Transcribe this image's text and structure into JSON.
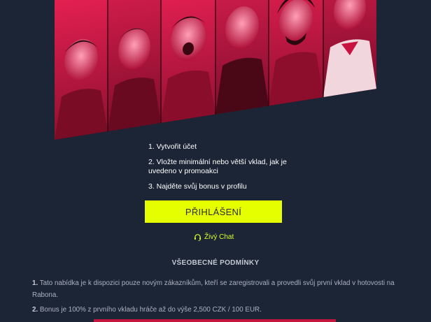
{
  "banner": {
    "players": [
      {
        "name": "player-1"
      },
      {
        "name": "player-2"
      },
      {
        "name": "player-3"
      },
      {
        "name": "player-4"
      },
      {
        "name": "player-5"
      },
      {
        "name": "player-6"
      }
    ],
    "accent_color": "#e0144a"
  },
  "steps": [
    {
      "text": "1. Vytvořit účet"
    },
    {
      "text": "2. Vložte minimální nebo větší vklad, jak je uvedeno v promoakci"
    },
    {
      "text": "3. Najděte svůj bonus v profilu"
    }
  ],
  "login_button": {
    "label": "PŘIHLÁŠENÍ",
    "color": "#e6ff00"
  },
  "chat": {
    "label": "Živý Chat",
    "icon": "headset-icon"
  },
  "terms": {
    "title": "VŠEOBECNÉ PODMÍNKY",
    "items": [
      {
        "num": "1.",
        "text": " Tato nabídka je k dispozici pouze novým zákazníkům, kteří se zaregistrovali a provedli svůj první vklad v hotovosti na Rabona."
      },
      {
        "num": "2.",
        "text": " Bonus je 100% z prvního vkladu hráče až do výše 2,500 CZK / 100 EUR."
      }
    ]
  }
}
